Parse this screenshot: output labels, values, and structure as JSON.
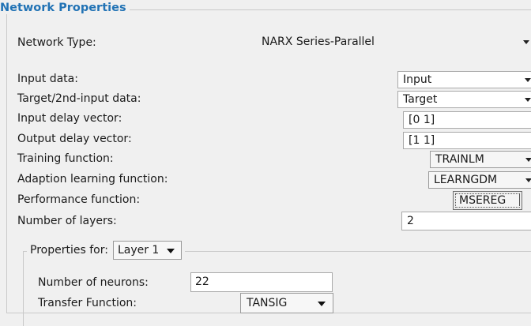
{
  "panel": {
    "title": "Network Properties"
  },
  "network_type": {
    "label": "Network Type:",
    "value": "NARX Series-Parallel"
  },
  "input_data": {
    "label": "Input data:",
    "value": "Input"
  },
  "target_data": {
    "label": "Target/2nd-input data:",
    "value": "Target"
  },
  "input_delay": {
    "label": "Input delay vector:",
    "value": "[0 1]"
  },
  "output_delay": {
    "label": "Output delay vector:",
    "value": "[1 1]"
  },
  "training_function": {
    "label": "Training function:",
    "value": "TRAINLM"
  },
  "adaption_function": {
    "label": "Adaption learning function:",
    "value": "LEARNGDM"
  },
  "performance_function": {
    "label": "Performance function:",
    "value": "MSEREG"
  },
  "num_layers": {
    "label": "Number of layers:",
    "value": "2"
  },
  "layer_props": {
    "label": "Properties for:",
    "selected_layer": "Layer 1",
    "neurons_label": "Number of neurons:",
    "neurons_value": "22",
    "transfer_label": "Transfer Function:",
    "transfer_value": "TANSIG"
  }
}
